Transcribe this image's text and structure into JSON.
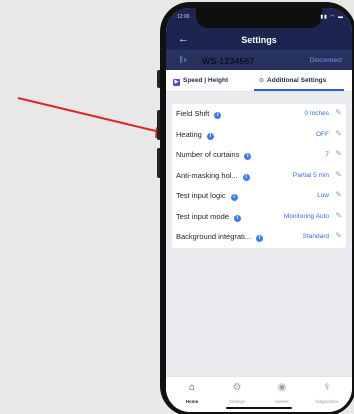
{
  "status": {
    "time": "12:00",
    "icons": "▮▮ ◠ ▬"
  },
  "header": {
    "back_glyph": "←",
    "title": "Settings"
  },
  "device": {
    "bt_glyph": "ᛒ›",
    "id": "WS-1234567",
    "disconnect_label": "Disconnect"
  },
  "tabs": [
    {
      "icon": "▶",
      "label": "Speed | Height"
    },
    {
      "icon": "⊙",
      "label": "Additional Settings"
    }
  ],
  "settings": [
    {
      "label": "Field Shift",
      "value": "0 Inches"
    },
    {
      "label": "Heating",
      "value": "OFF"
    },
    {
      "label": "Number of curtains",
      "value": "7"
    },
    {
      "label": "Anti-masking hol...",
      "value": "Partial 5 min"
    },
    {
      "label": "Test input logic",
      "value": "Low"
    },
    {
      "label": "Test input mode",
      "value": "Monitoring Auto"
    },
    {
      "label": "Background integrati...",
      "value": "Standard"
    }
  ],
  "info_glyph": "i",
  "edit_glyph": "✎",
  "bottom_nav": [
    {
      "icon": "⌂",
      "label": "Home"
    },
    {
      "icon": "⚙",
      "label": "Settings"
    },
    {
      "icon": "◉",
      "label": "Viewer"
    },
    {
      "icon": "⚕",
      "label": "Diagnostics"
    }
  ],
  "colors": {
    "header": "#1b2550",
    "accent": "#2f57e4",
    "arrow": "#d62a2a"
  }
}
